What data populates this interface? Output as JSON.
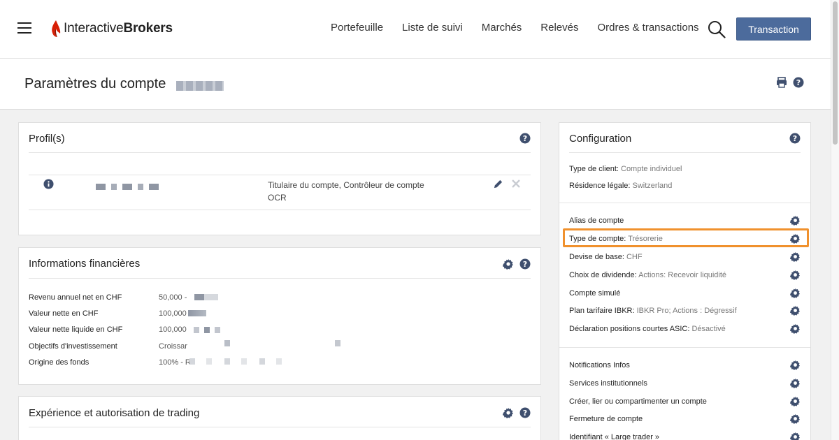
{
  "brand": {
    "name_regular": "Interactive",
    "name_bold": "Brokers"
  },
  "nav": {
    "items": [
      "Portefeuille",
      "Liste de suivi",
      "Marchés",
      "Relevés",
      "Ordres & transactions"
    ],
    "trade_button": "Transaction"
  },
  "page": {
    "title": "Paramètres du compte"
  },
  "profile": {
    "title": "Profil(s)",
    "role_line1": "Titulaire du compte, Contrôleur de compte",
    "role_line2": "OCR"
  },
  "financial": {
    "title": "Informations financières",
    "rows": [
      {
        "label": "Revenu annuel net en CHF",
        "value": "50,000 -"
      },
      {
        "label": "Valeur nette en CHF",
        "value": "100,000"
      },
      {
        "label": "Valeur nette liquide en CHF",
        "value": "100,000"
      },
      {
        "label": "Objectifs d'investissement",
        "value": "Croissar"
      },
      {
        "label": "Origine des fonds",
        "value": "100% - R"
      }
    ]
  },
  "trading": {
    "title": "Expérience et autorisation de trading"
  },
  "configuration": {
    "title": "Configuration",
    "client_type_label": "Type de client:",
    "client_type_value": "Compte individuel",
    "residence_label": "Résidence légale:",
    "residence_value": "Switzerland",
    "settings": [
      {
        "label": "Alias de compte",
        "value": ""
      },
      {
        "label": "Type de compte:",
        "value": "Trésorerie"
      },
      {
        "label": "Devise de base:",
        "value": "CHF"
      },
      {
        "label": "Choix de dividende:",
        "value": "Actions: Recevoir liquidité"
      },
      {
        "label": "Compte simulé",
        "value": ""
      },
      {
        "label": "Plan tarifaire IBKR:",
        "value": "IBKR Pro; Actions : Dégressif"
      },
      {
        "label": "Déclaration positions courtes ASIC:",
        "value": "Désactivé"
      }
    ],
    "services": [
      "Notifications Infos",
      "Services institutionnels",
      "Créer, lier ou compartimenter un compte",
      "Fermeture de compte",
      "Identifiant « Large trader »"
    ]
  },
  "colors": {
    "accent": "#4c6b9c",
    "highlight": "#f0912d",
    "icon": "#4a5a78"
  }
}
